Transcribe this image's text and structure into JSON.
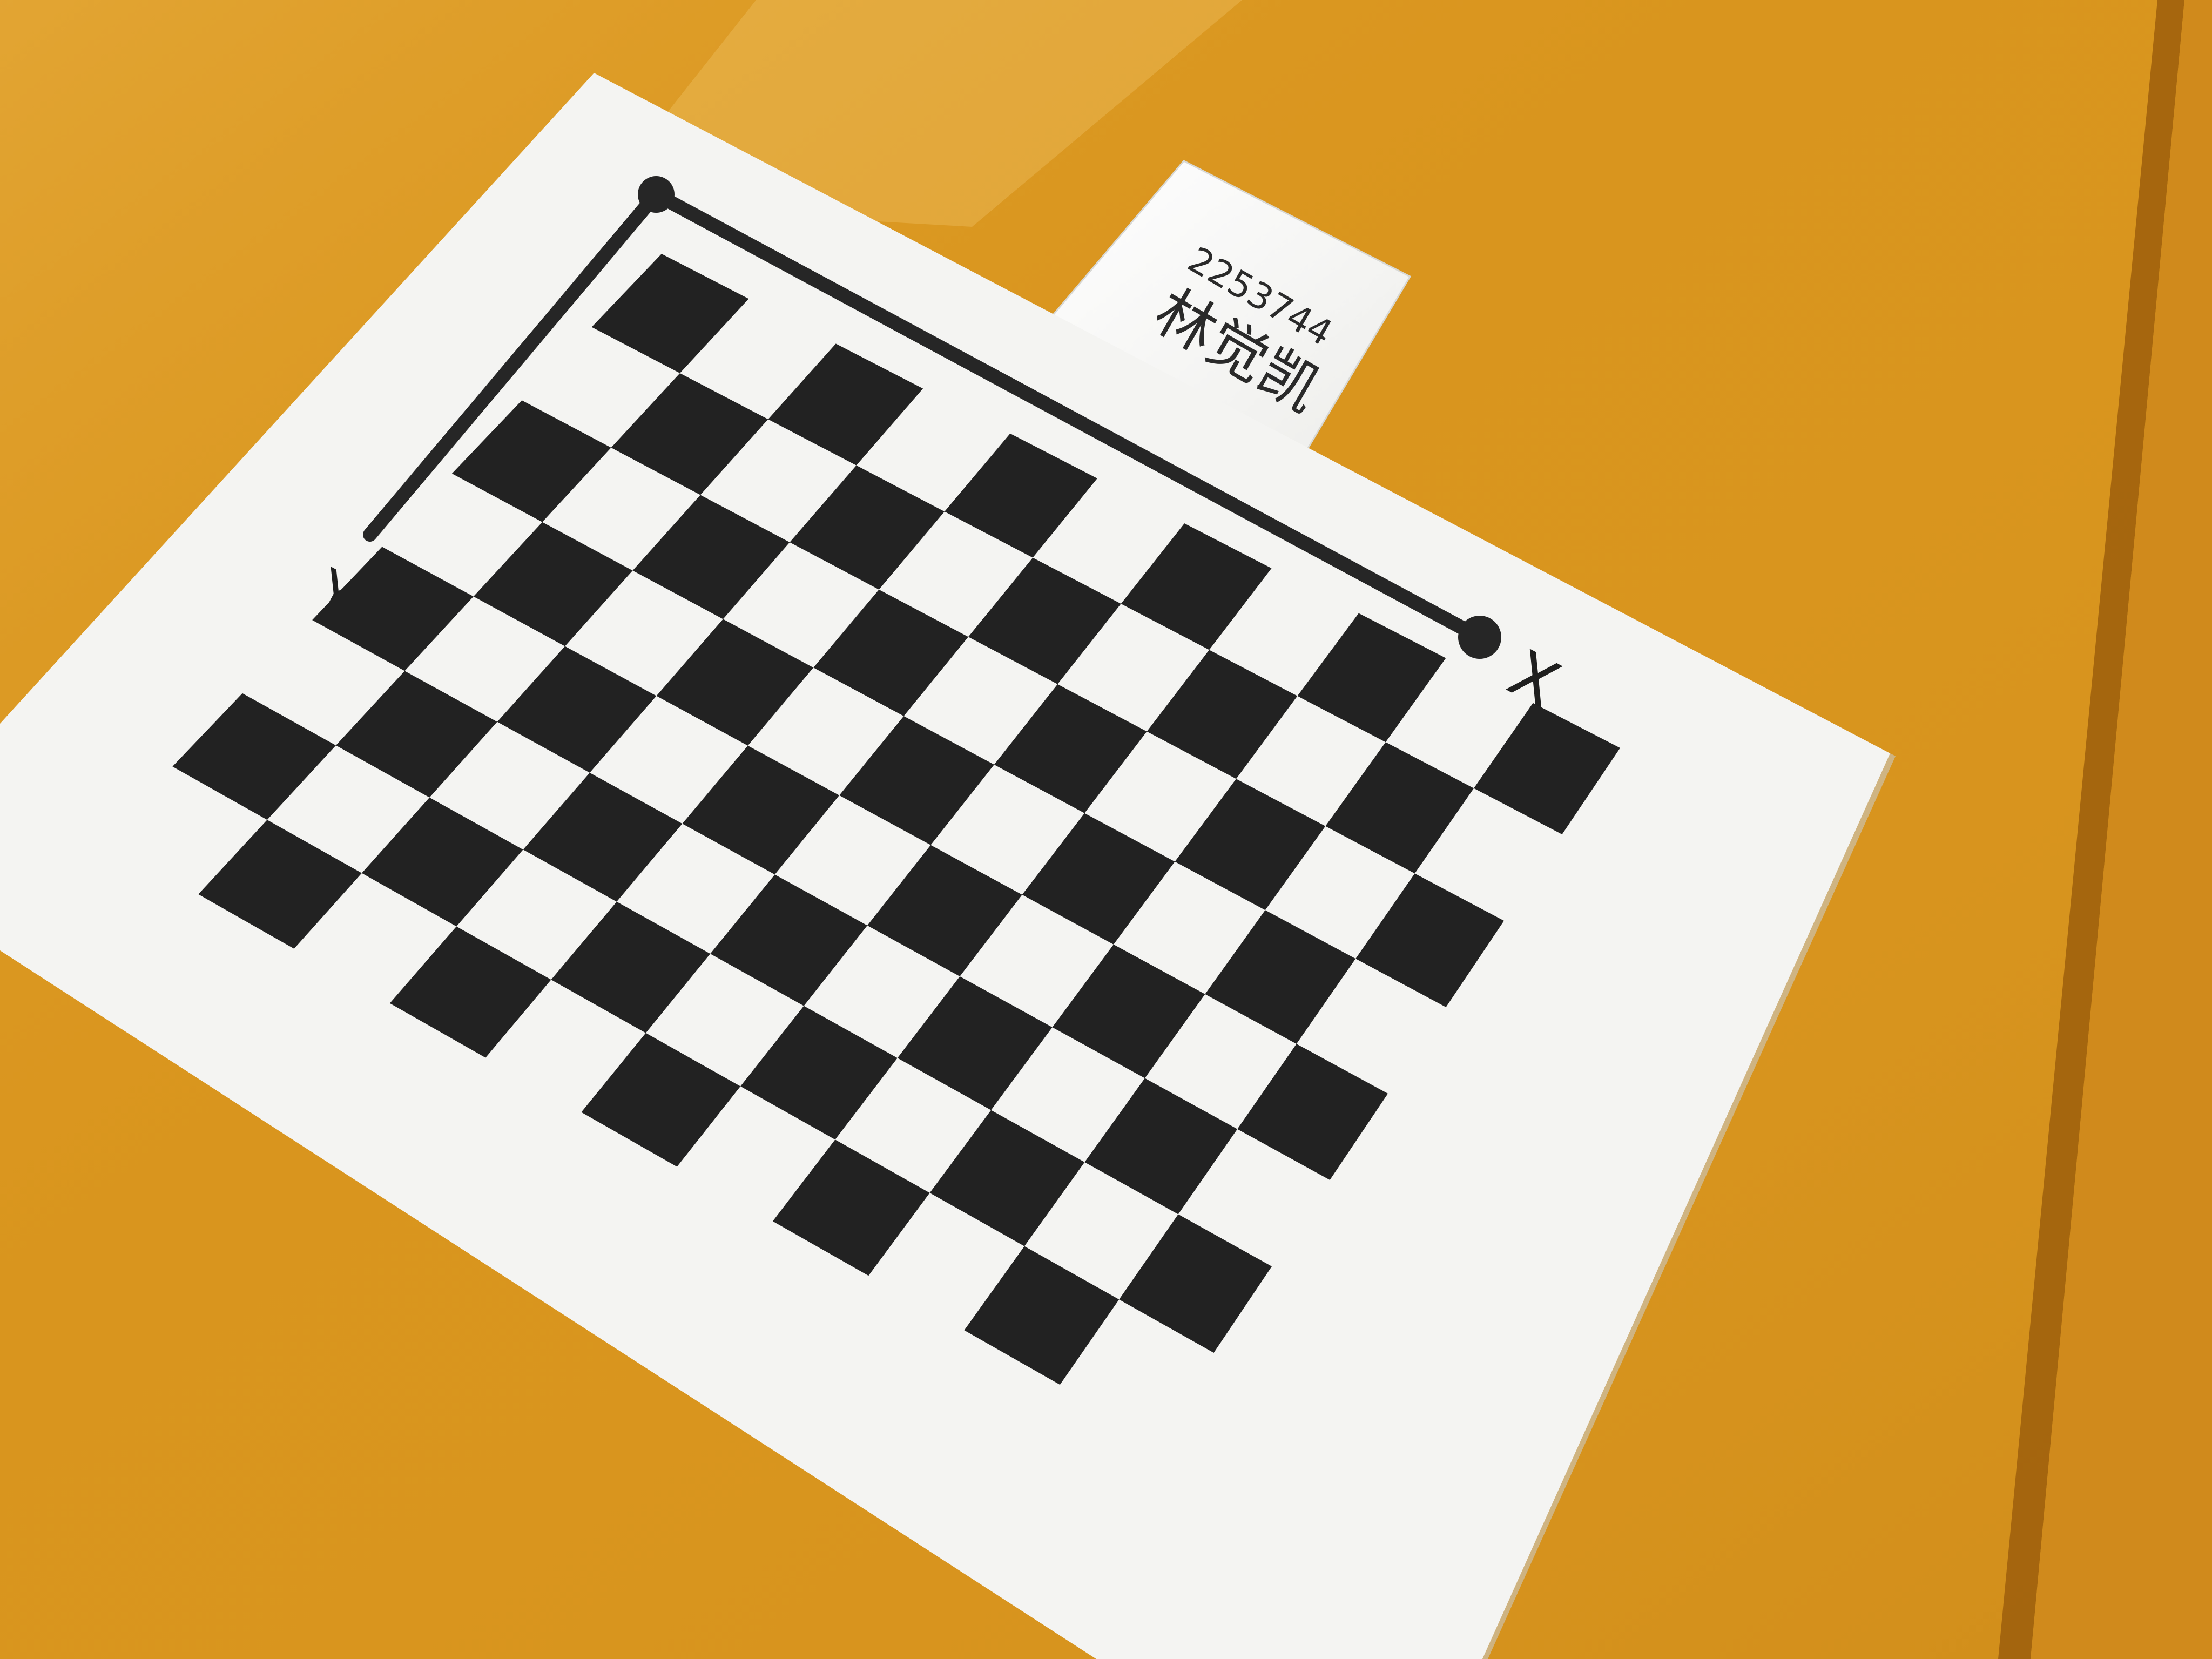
{
  "scene": {
    "description_role": "photo",
    "table_color": "#d9951e",
    "paper_color": "#f4f4f2",
    "square_color": "#222222"
  },
  "calibration_board": {
    "rows": 8,
    "columns": 11,
    "axis_x_label": "X",
    "axis_y_label": "Y"
  },
  "sticky_note": {
    "id_number": "2253744",
    "name": "林觉凯"
  }
}
